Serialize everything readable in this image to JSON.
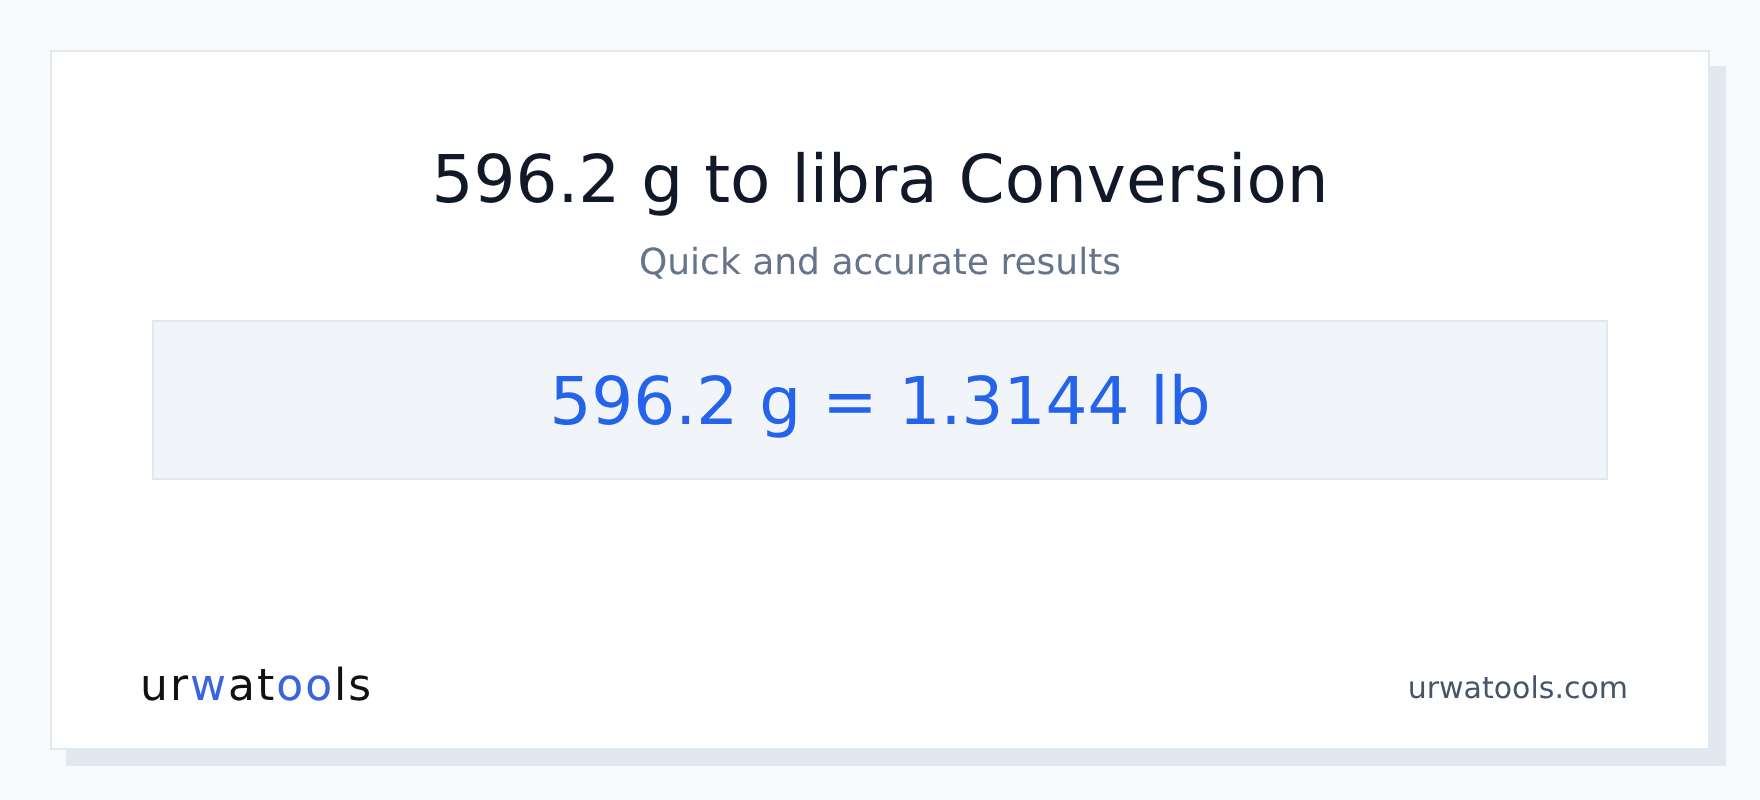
{
  "title": "596.2 g to libra Conversion",
  "subtitle": "Quick and accurate results",
  "result": "596.2 g = 1.3144 lb",
  "logo": {
    "parts": [
      {
        "text": "ur",
        "accent": false
      },
      {
        "text": "w",
        "accent": true
      },
      {
        "text": "at",
        "accent": false
      },
      {
        "text": "oo",
        "accent": true
      },
      {
        "text": "ls",
        "accent": false
      }
    ]
  },
  "site": "urwatools.com"
}
